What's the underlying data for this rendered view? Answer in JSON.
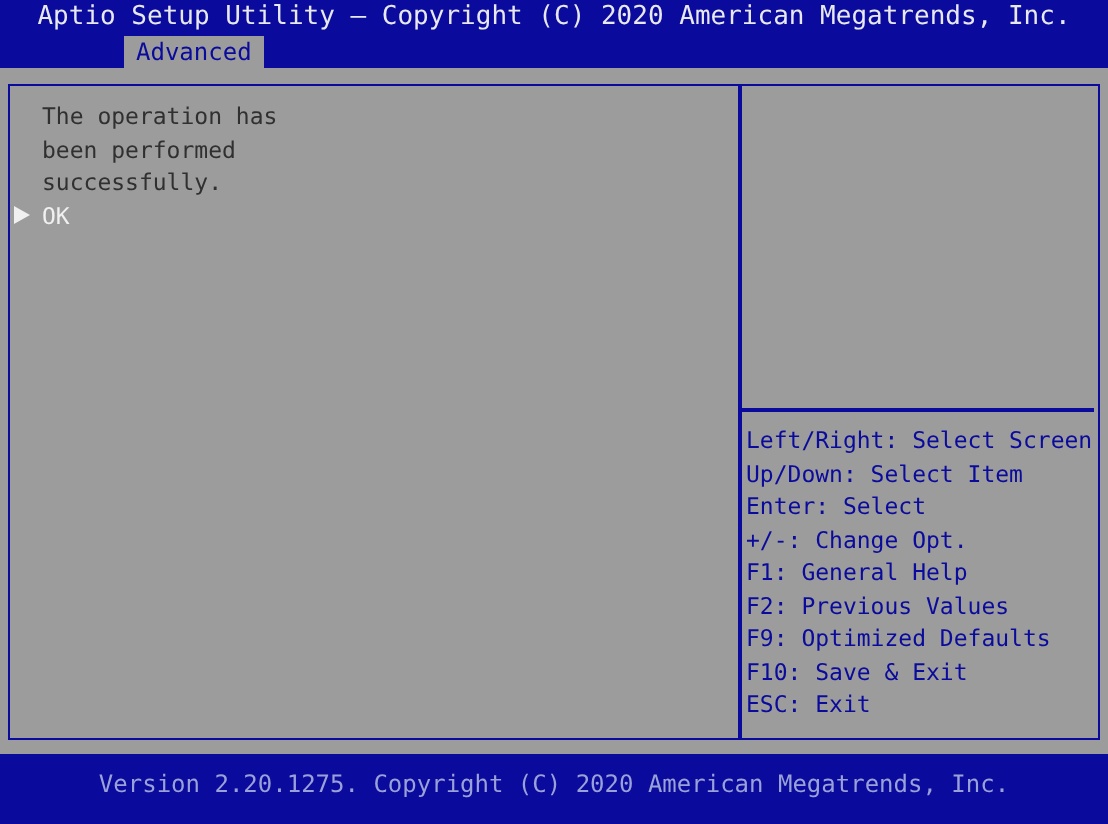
{
  "header": {
    "title": "Aptio Setup Utility – Copyright (C) 2020 American Megatrends, Inc."
  },
  "tabs": [
    {
      "label": "Advanced",
      "selected": true
    }
  ],
  "message": {
    "lines": [
      "The operation has",
      "been performed",
      "successfully."
    ]
  },
  "options": [
    {
      "label": "OK",
      "selected": true
    }
  ],
  "help": [
    "Left/Right: Select Screen",
    "Up/Down: Select Item",
    "Enter: Select",
    "+/-: Change Opt.",
    "F1: General Help",
    "F2: Previous Values",
    "F9: Optimized Defaults",
    "F10: Save & Exit",
    "ESC: Exit"
  ],
  "footer": {
    "version": "Version 2.20.1275. Copyright (C) 2020 American Megatrends, Inc."
  }
}
